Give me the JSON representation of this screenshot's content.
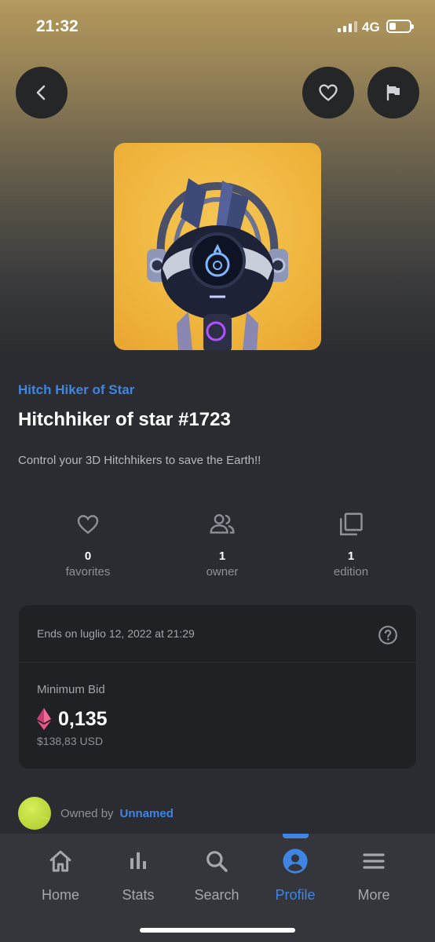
{
  "status_bar": {
    "time": "21:32",
    "network": "4G"
  },
  "header": {
    "back_icon": "chevron-left-icon",
    "favorite_icon": "heart-icon",
    "report_icon": "flag-icon"
  },
  "nft": {
    "collection": "Hitch Hiker of Star",
    "title": "Hitchhiker of star #1723",
    "description": "Control your 3D Hitchhikers to save the Earth!!"
  },
  "stats": [
    {
      "icon": "heart-outline-icon",
      "value": "0",
      "label": "favorites"
    },
    {
      "icon": "people-icon",
      "value": "1",
      "label": "owner"
    },
    {
      "icon": "copies-icon",
      "value": "1",
      "label": "edition"
    }
  ],
  "auction": {
    "ends": "Ends on luglio 12, 2022 at 21:29",
    "min_bid_label": "Minimum Bid",
    "amount": "0,135",
    "usd": "$138,83 USD"
  },
  "owner": {
    "prefix": "Owned by",
    "name": "Unnamed"
  },
  "tabs": [
    {
      "icon": "home-icon",
      "label": "Home"
    },
    {
      "icon": "bar-chart-icon",
      "label": "Stats"
    },
    {
      "icon": "search-icon",
      "label": "Search"
    },
    {
      "icon": "profile-icon",
      "label": "Profile",
      "active": true
    },
    {
      "icon": "menu-icon",
      "label": "More"
    }
  ],
  "colors": {
    "accent": "#3f86e4",
    "background": "#2a2c31",
    "card": "#202125",
    "tabbar": "#34363b",
    "eth": "#e5558a"
  }
}
